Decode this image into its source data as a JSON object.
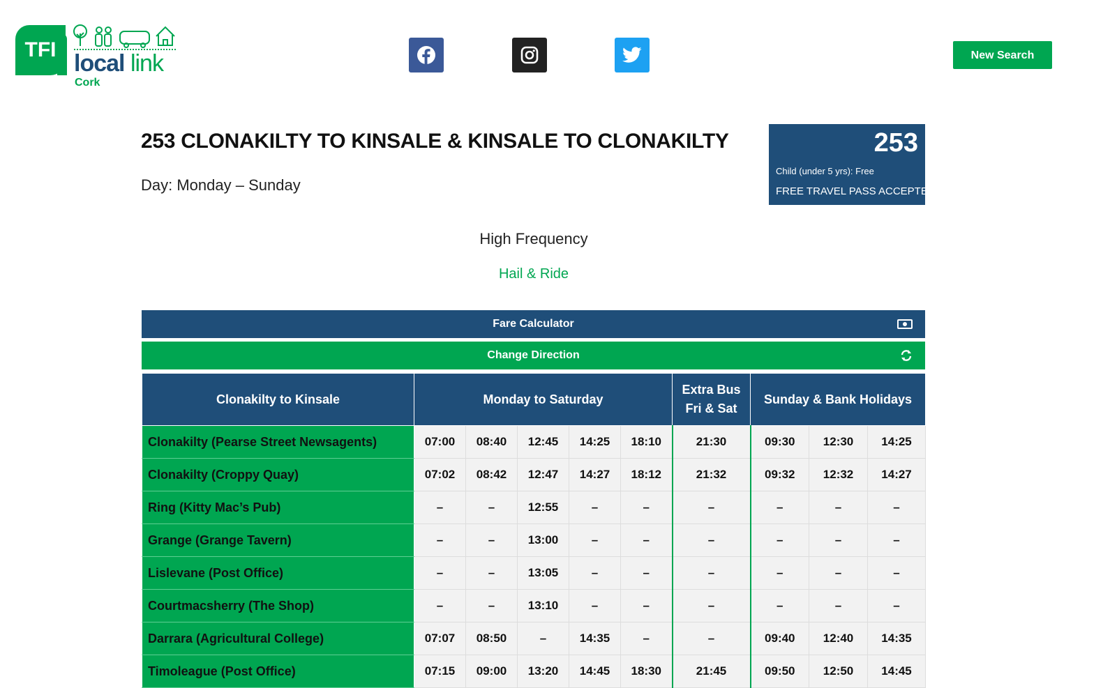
{
  "brand": {
    "tfi": "TFI",
    "word_local": "local",
    "word_link": "link",
    "city": "Cork"
  },
  "social": {
    "facebook": "facebook-icon",
    "instagram": "instagram-icon",
    "twitter": "twitter-icon"
  },
  "header": {
    "new_search": "New Search"
  },
  "route": {
    "title": "253 CLONAKILTY TO KINSALE & KINSALE TO CLONAKILTY",
    "days": "Day: Monday – Sunday",
    "number": "253",
    "child_fare": "Child (under 5 yrs): Free",
    "pass": "FREE TRAVEL PASS ACCEPTED",
    "frequency": "High Frequency",
    "service_type": "Hail & Ride"
  },
  "actions": {
    "fare_calculator": "Fare Calculator",
    "change_direction": "Change Direction"
  },
  "timetable": {
    "headers": {
      "direction": "Clonakilty to Kinsale",
      "mon_sat": "Monday to Saturday",
      "extra_line1": "Extra Bus",
      "extra_line2": "Fri & Sat",
      "sunday": "Sunday & Bank Holidays"
    },
    "rows": [
      {
        "stop": "Clonakilty (Pearse Street Newsagents)",
        "times": [
          "07:00",
          "08:40",
          "12:45",
          "14:25",
          "18:10",
          "21:30",
          "09:30",
          "12:30",
          "14:25"
        ]
      },
      {
        "stop": "Clonakilty (Croppy Quay)",
        "times": [
          "07:02",
          "08:42",
          "12:47",
          "14:27",
          "18:12",
          "21:32",
          "09:32",
          "12:32",
          "14:27"
        ]
      },
      {
        "stop": "Ring (Kitty Mac’s Pub)",
        "times": [
          "–",
          "–",
          "12:55",
          "–",
          "–",
          "–",
          "–",
          "–",
          "–"
        ]
      },
      {
        "stop": "Grange (Grange Tavern)",
        "times": [
          "–",
          "–",
          "13:00",
          "–",
          "–",
          "–",
          "–",
          "–",
          "–"
        ]
      },
      {
        "stop": "Lislevane (Post Office)",
        "times": [
          "–",
          "–",
          "13:05",
          "–",
          "–",
          "–",
          "–",
          "–",
          "–"
        ]
      },
      {
        "stop": "Courtmacsherry (The Shop)",
        "times": [
          "–",
          "–",
          "13:10",
          "–",
          "–",
          "–",
          "–",
          "–",
          "–"
        ]
      },
      {
        "stop": "Darrara (Agricultural College)",
        "times": [
          "07:07",
          "08:50",
          "–",
          "14:35",
          "–",
          "–",
          "09:40",
          "12:40",
          "14:35"
        ]
      },
      {
        "stop": "Timoleague (Post Office)",
        "times": [
          "07:15",
          "09:00",
          "13:20",
          "14:45",
          "18:30",
          "21:45",
          "09:50",
          "12:50",
          "14:45"
        ]
      }
    ]
  },
  "colors": {
    "navy": "#1f4e79",
    "green": "#00a651"
  }
}
